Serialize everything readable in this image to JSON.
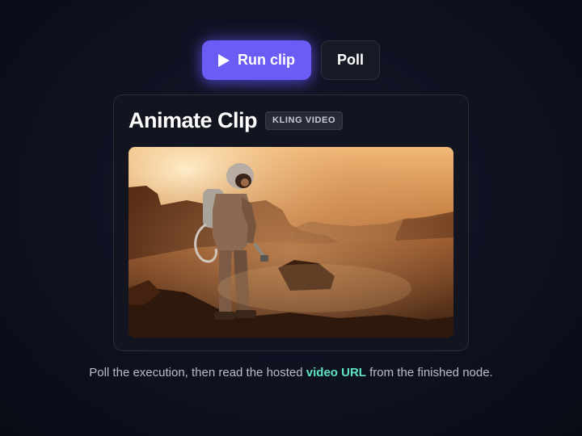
{
  "actions": {
    "run_label": "Run clip",
    "poll_label": "Poll"
  },
  "card": {
    "title": "Animate Clip",
    "badge": "KLING VIDEO",
    "video_alt": "Astronaut in a spacesuit standing on a dusty rocky desert landscape at sunset"
  },
  "caption": {
    "before": "Poll the execution, then read the hosted ",
    "link": "video URL",
    "after": " from the finished node."
  },
  "icons": {
    "run": "play-icon"
  },
  "colors": {
    "accent": "#6b5cf6",
    "link": "#5ee3c5",
    "background": "#0e1120"
  }
}
